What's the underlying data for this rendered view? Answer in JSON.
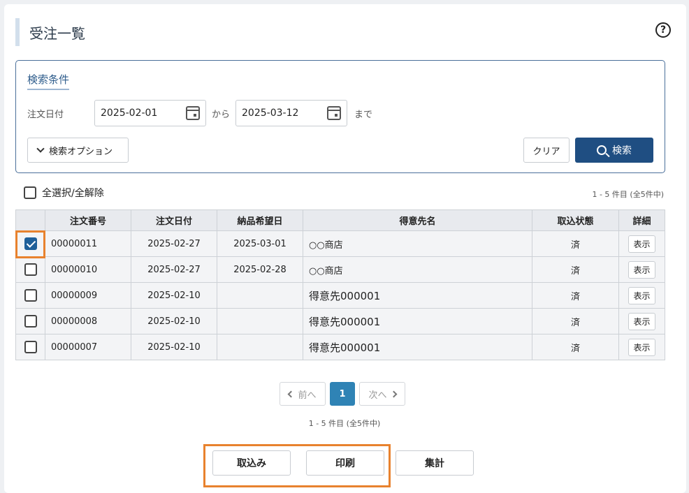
{
  "page": {
    "title": "受注一覧",
    "help_icon": "help-icon",
    "help_glyph": "?"
  },
  "search": {
    "heading": "検索条件",
    "date_label": "注文日付",
    "date_from": "2025-02-01",
    "from_suffix": "から",
    "date_to": "2025-03-12",
    "to_suffix": "まで",
    "options_label": "検索オプション",
    "clear_label": "クリア",
    "search_label": "検索"
  },
  "list": {
    "select_all_label": "全選択/全解除",
    "count_text": "1 - 5 件目 (全5件中)",
    "columns": [
      "注文番号",
      "注文日付",
      "納品希望日",
      "得意先名",
      "取込状態",
      "詳細"
    ],
    "rows": [
      {
        "checked": true,
        "order_no": "00000011",
        "order_date": "2025-02-27",
        "delivery": "2025-03-01",
        "customer": "○○商店",
        "status": "済",
        "detail": "表示"
      },
      {
        "checked": false,
        "order_no": "00000010",
        "order_date": "2025-02-27",
        "delivery": "2025-02-28",
        "customer": "○○商店",
        "status": "済",
        "detail": "表示"
      },
      {
        "checked": false,
        "order_no": "00000009",
        "order_date": "2025-02-10",
        "delivery": "",
        "customer": "得意先000001",
        "status": "済",
        "detail": "表示"
      },
      {
        "checked": false,
        "order_no": "00000008",
        "order_date": "2025-02-10",
        "delivery": "",
        "customer": "得意先000001",
        "status": "済",
        "detail": "表示"
      },
      {
        "checked": false,
        "order_no": "00000007",
        "order_date": "2025-02-10",
        "delivery": "",
        "customer": "得意先000001",
        "status": "済",
        "detail": "表示"
      }
    ]
  },
  "pagination": {
    "prev": "前へ",
    "current": "1",
    "next": "次へ",
    "count_text": "1 - 5 件目 (全5件中)"
  },
  "actions": {
    "import": "取込み",
    "print": "印刷",
    "summary": "集計"
  },
  "colors": {
    "accent": "#1f4e82",
    "highlight": "#e8822e",
    "page_current": "#2f83b5"
  }
}
